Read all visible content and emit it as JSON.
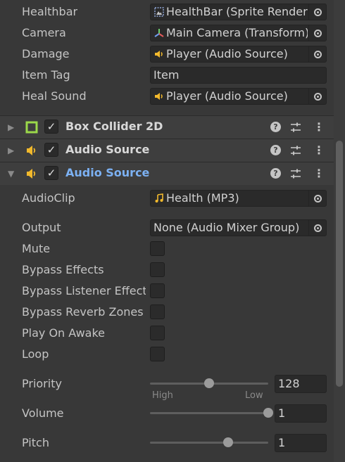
{
  "object_fields": [
    {
      "label": "Healthbar",
      "value": "HealthBar (Sprite Renderer)",
      "icon": "sprite-renderer-icon"
    },
    {
      "label": "Camera",
      "value": "Main Camera (Transform)",
      "icon": "transform-icon"
    },
    {
      "label": "Damage",
      "value": "Player (Audio Source)",
      "icon": "audio-source-icon"
    },
    {
      "label": "Item Tag",
      "value": "Item"
    },
    {
      "label": "Heal Sound",
      "value": "Player (Audio Source)",
      "icon": "audio-source-icon"
    }
  ],
  "components": [
    {
      "title": "Box Collider 2D",
      "expanded": false,
      "enabled": true,
      "icon": "box-collider-icon"
    },
    {
      "title": "Audio Source",
      "expanded": false,
      "enabled": true,
      "icon": "audio-source-icon"
    },
    {
      "title": "Audio Source",
      "expanded": true,
      "enabled": true,
      "icon": "audio-source-icon"
    }
  ],
  "audio_source": {
    "audio_clip": {
      "label": "AudioClip",
      "value": "Health (MP3)",
      "icon": "audio-clip-icon"
    },
    "output": {
      "label": "Output",
      "value": "None (Audio Mixer Group)"
    },
    "toggles": [
      {
        "label": "Mute",
        "checked": false
      },
      {
        "label": "Bypass Effects",
        "checked": false
      },
      {
        "label": "Bypass Listener Effects",
        "checked": false
      },
      {
        "label": "Bypass Reverb Zones",
        "checked": false
      },
      {
        "label": "Play On Awake",
        "checked": false
      },
      {
        "label": "Loop",
        "checked": false
      }
    ],
    "priority": {
      "label": "Priority",
      "value": "128",
      "fraction": 0.5,
      "low_label": "Low",
      "high_label": "High"
    },
    "volume": {
      "label": "Volume",
      "value": "1",
      "fraction": 1.0
    },
    "pitch": {
      "label": "Pitch",
      "value": "1",
      "fraction": 0.66
    }
  },
  "colors": {
    "background": "#383838",
    "header": "#3e3e3e",
    "active_title": "#7cb1f3",
    "audio_icon": "#f2b92c",
    "collider_icon": "#9bd84a"
  }
}
